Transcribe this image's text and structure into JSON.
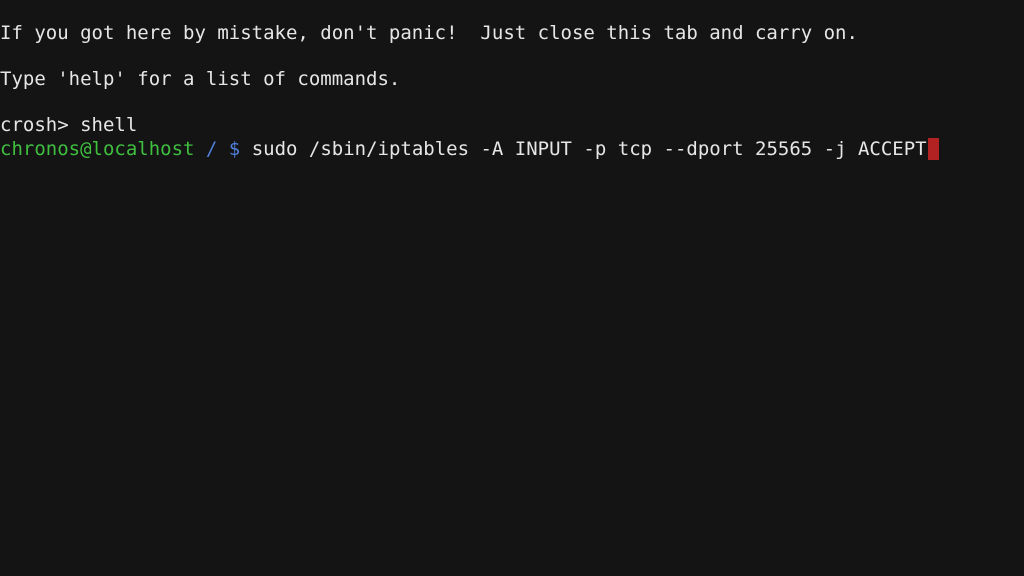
{
  "terminal": {
    "lines": {
      "intro": "If you got here by mistake, don't panic!  Just close this tab and carry on.",
      "help": "Type 'help' for a list of commands.",
      "crosh_prompt": "crosh> shell"
    },
    "shell": {
      "user_host": "chronos@localhost",
      "path": "/ $",
      "command": "sudo /sbin/iptables -A INPUT -p tcp --dport 25565 -j ACCEPT"
    },
    "colors": {
      "background": "#141414",
      "text": "#e6e6e6",
      "user_host": "#3fbf3f",
      "path": "#4f7fd8",
      "cursor": "#b22222"
    }
  }
}
